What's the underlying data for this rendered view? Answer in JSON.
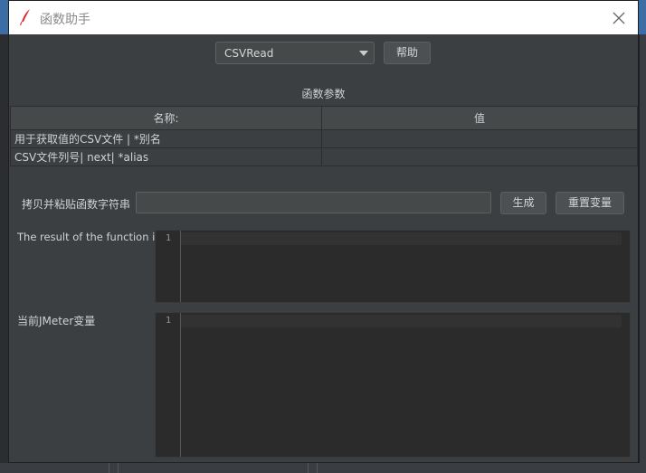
{
  "window": {
    "title": "函数助手"
  },
  "function_select": {
    "value": "CSVRead"
  },
  "help_button": "帮助",
  "params": {
    "title": "函数参数",
    "columns": [
      "名称:",
      "值"
    ],
    "rows": [
      {
        "name": "用于获取值的CSV文件 | *别名",
        "value": ""
      },
      {
        "name": "CSV文件列号| next| *alias",
        "value": ""
      }
    ]
  },
  "paste": {
    "label": "拷贝并粘贴函数字符串",
    "value": "",
    "generate_button": "生成",
    "reset_button": "重置变量"
  },
  "result": {
    "label": "The result of the function is",
    "line_number": "1"
  },
  "vars": {
    "label": "当前JMeter变量",
    "line_number": "1"
  },
  "colors": {
    "dialog_bg": "#3c3f41",
    "editor_bg": "#2b2b2b",
    "titlebar_bg": "#ffffff"
  },
  "icons": [
    "feather-icon",
    "close-icon",
    "chevron-down-icon"
  ]
}
